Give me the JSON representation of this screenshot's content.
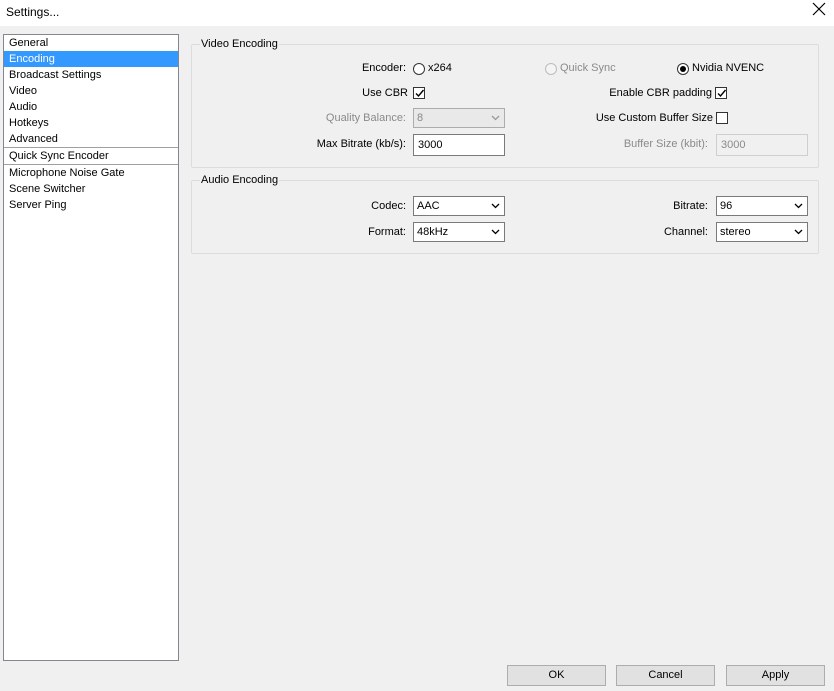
{
  "window": {
    "title": "Settings..."
  },
  "sidebar": {
    "items": [
      {
        "label": "General"
      },
      {
        "label": "Encoding"
      },
      {
        "label": "Broadcast Settings"
      },
      {
        "label": "Video"
      },
      {
        "label": "Audio"
      },
      {
        "label": "Hotkeys"
      },
      {
        "label": "Advanced"
      },
      {
        "label": "Quick Sync Encoder"
      },
      {
        "label": "Microphone Noise Gate"
      },
      {
        "label": "Scene Switcher"
      },
      {
        "label": "Server Ping"
      }
    ],
    "selected": "Encoding"
  },
  "video_encoding": {
    "title": "Video Encoding",
    "encoder_label": "Encoder:",
    "encoder_options": [
      {
        "label": "x264",
        "checked": false,
        "enabled": true
      },
      {
        "label": "Quick Sync",
        "checked": false,
        "enabled": false
      },
      {
        "label": "Nvidia NVENC",
        "checked": true,
        "enabled": true
      }
    ],
    "use_cbr_label": "Use CBR",
    "use_cbr_checked": true,
    "enable_cbr_padding_label": "Enable CBR padding",
    "enable_cbr_padding_checked": true,
    "quality_balance_label": "Quality Balance:",
    "quality_balance_value": "8",
    "use_custom_buffer_label": "Use Custom Buffer Size",
    "use_custom_buffer_checked": false,
    "max_bitrate_label": "Max Bitrate (kb/s):",
    "max_bitrate_value": "3000",
    "buffer_size_label": "Buffer Size (kbit):",
    "buffer_size_value": "3000"
  },
  "audio_encoding": {
    "title": "Audio Encoding",
    "codec_label": "Codec:",
    "codec_value": "AAC",
    "bitrate_label": "Bitrate:",
    "bitrate_value": "96",
    "format_label": "Format:",
    "format_value": "48kHz",
    "channel_label": "Channel:",
    "channel_value": "stereo"
  },
  "buttons": {
    "ok": "OK",
    "cancel": "Cancel",
    "apply": "Apply"
  }
}
